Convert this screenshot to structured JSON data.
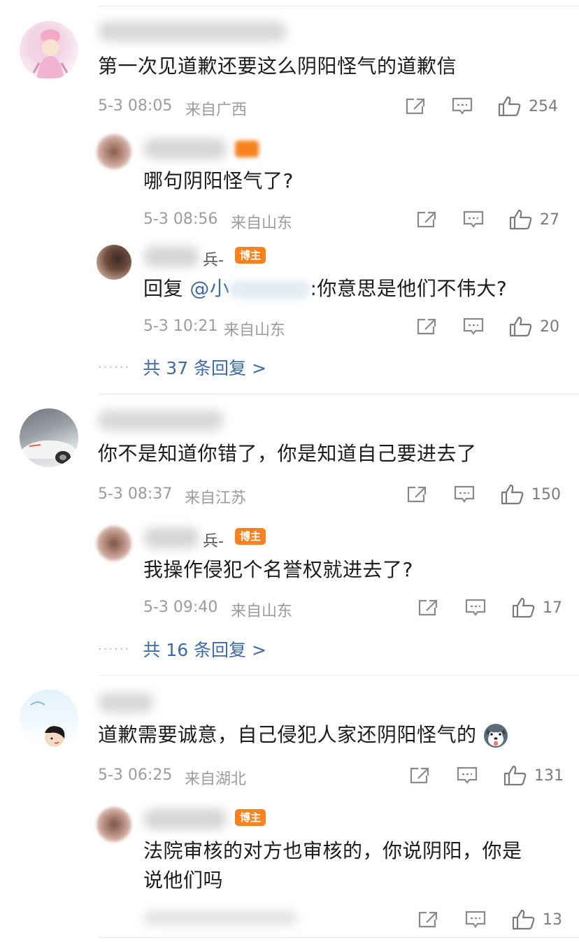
{
  "comments": [
    {
      "text": "第一次见道歉还要这么阴阳怪气的道歉信",
      "time": "5-3 08:05",
      "location": "来自广西",
      "likes": "254",
      "replies": [
        {
          "text": "哪句阴阳怪气了?",
          "time": "5-3 08:56",
          "location": "来自山东",
          "likes": "27"
        },
        {
          "prefix": "回复",
          "mention": "@小",
          "suffix": ":你意思是他们不伟大?",
          "name_frag": "兵-",
          "badge": "博主",
          "time": "5-3 10:21",
          "location": "来自山东",
          "likes": "20"
        }
      ],
      "more": "共 37 条回复 >"
    },
    {
      "text": "你不是知道你错了，你是知道自己要进去了",
      "time": "5-3 08:37",
      "location": "来自江苏",
      "likes": "150",
      "replies": [
        {
          "text": "我操作侵犯个名誉权就进去了?",
          "name_frag": "兵-",
          "badge": "博主",
          "time": "5-3 09:40",
          "location": "来自山东",
          "likes": "17"
        }
      ],
      "more": "共 16 条回复 >"
    },
    {
      "text": "道歉需要诚意，自己侵犯人家还阴阳怪气的",
      "time": "5-3 06:25",
      "location": "来自湖北",
      "likes": "131",
      "replies": [
        {
          "line1": "法院审核的对方也审核的，你说阴阳，你是",
          "line2": "说他们吗",
          "badge": "博主",
          "likes": "13"
        }
      ]
    }
  ],
  "colors": {
    "badge": "#f7821f",
    "link": "#3f6aa6",
    "meta": "#9c9c9c"
  },
  "icons": [
    "share-icon",
    "comment-icon",
    "like-icon",
    "husky-emoji-icon"
  ]
}
